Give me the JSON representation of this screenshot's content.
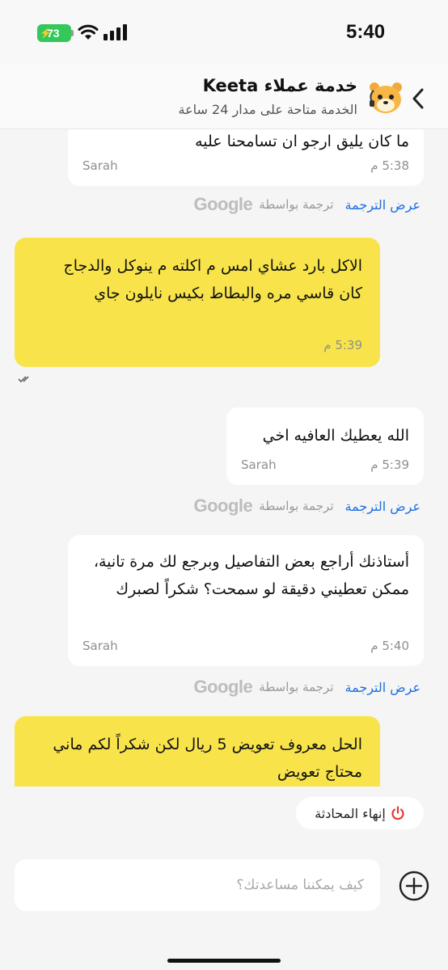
{
  "status_bar": {
    "time": "5:40",
    "battery": "73"
  },
  "header": {
    "title": "خدمة عملاء Keeta",
    "subtitle": "الخدمة متاحة على مدار 24 ساعة"
  },
  "translation": {
    "link": "عرض الترجمة",
    "by": "ترجمة بواسطة",
    "provider": "Google"
  },
  "messages": [
    {
      "from": "agent",
      "sender": "Sarah",
      "time": "5:38 م",
      "text": "ما كان يليق ارجو ان تسامحنا عليه"
    },
    {
      "from": "user",
      "time": "5:39 م",
      "text": "الاكل بارد عشاي امس م اكلته م ينوكل والدجاج كان قاسي مره والبطاط بكيس نايلون جاي"
    },
    {
      "from": "agent",
      "sender": "Sarah",
      "time": "5:39 م",
      "text": "الله يعطيك العافيه اخي"
    },
    {
      "from": "agent",
      "sender": "Sarah",
      "time": "5:40 م",
      "text": "أستاذنك أراجع بعض التفاصيل وبرجع لك مرة تانية، ممكن تعطيني دقيقة لو سمحت؟ شكراً لصبرك"
    },
    {
      "from": "user",
      "time": "",
      "text": "الحل معروف تعويض 5 ريال لكن شكراً لكم ماني محتاج تعويض"
    }
  ],
  "end_chat": {
    "label": "إنهاء المحادثة"
  },
  "composer": {
    "placeholder": "كيف يمكننا مساعدتك؟"
  },
  "colors": {
    "user_bubble": "#f8e44a",
    "link": "#1e6fe0",
    "end_icon": "#e53935"
  }
}
